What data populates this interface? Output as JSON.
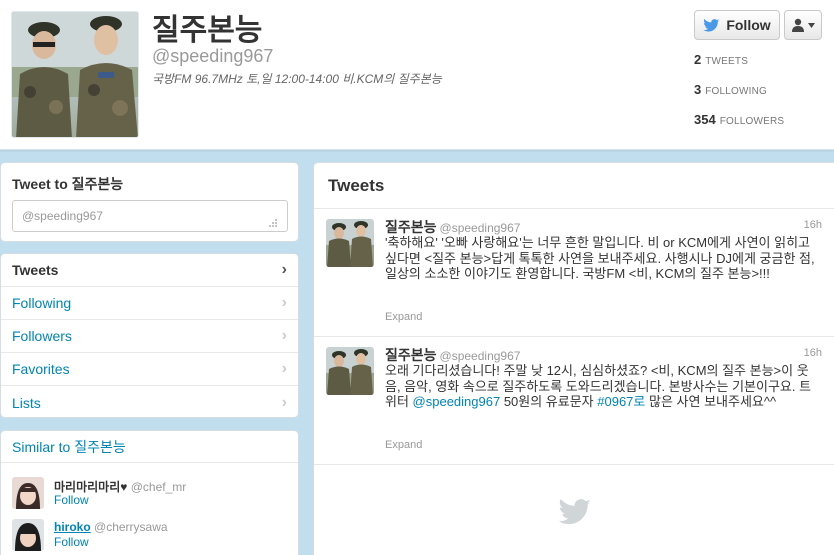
{
  "profile": {
    "name": "질주본능",
    "handle": "@speeding967",
    "bio": "국방FM 96.7MHz 토,일 12:00-14:00 비.KCM의 질주본능",
    "follow_label": "Follow",
    "stats": [
      {
        "num": "2",
        "label": "TWEETS"
      },
      {
        "num": "3",
        "label": "FOLLOWING"
      },
      {
        "num": "354",
        "label": "FOLLOWERS"
      }
    ]
  },
  "tweet_box": {
    "title": "Tweet to 질주본능",
    "placeholder": "@speeding967"
  },
  "nav": {
    "items": [
      {
        "label": "Tweets"
      },
      {
        "label": "Following"
      },
      {
        "label": "Followers"
      },
      {
        "label": "Favorites"
      },
      {
        "label": "Lists"
      }
    ]
  },
  "similar": {
    "title": "Similar to 질주본능",
    "users": [
      {
        "name": "마리마리마리♥",
        "handle": "@chef_mr",
        "action": "Follow"
      },
      {
        "name": "hiroko",
        "handle": "@cherrysawa",
        "action": "Follow"
      }
    ]
  },
  "timeline": {
    "title": "Tweets",
    "tweets": [
      {
        "name": "질주본능",
        "handle": "@speeding967",
        "time": "16h",
        "text": "'축하해요' '오빠 사랑해요'는 너무 흔한 말입니다. 비 or KCM에게 사연이 읽히고 싶다면 <질주 본능>답게 톡톡한 사연을 보내주세요. 사행시나 DJ에게 궁금한 점, 일상의 소소한 이야기도 환영합니다. 국방FM <비, KCM의 질주 본능>!!!",
        "expand": "Expand"
      },
      {
        "name": "질주본능",
        "handle": "@speeding967",
        "time": "16h",
        "text_before": "오래 기다리셨습니다! 주말 낮 12시, 심심하셨죠? <비, KCM의 질주 본능>이 웃음, 음악, 영화 속으로 질주하도록 도와드리겠습니다. 본방사수는 기본이구요. 트위터 ",
        "mention": "@speeding967",
        "text_middle": " 50원의 유료문자 ",
        "hashtag": "#0967로",
        "text_after": " 많은 사연 보내주세요^^",
        "expand": "Expand"
      }
    ]
  },
  "colors": {
    "background": "#c0deed",
    "link": "#0084b4",
    "text": "#333333",
    "muted": "#999999"
  },
  "icons": [
    "twitter-bird-icon",
    "person-icon",
    "chevron-right-icon",
    "resize-grip-icon"
  ]
}
